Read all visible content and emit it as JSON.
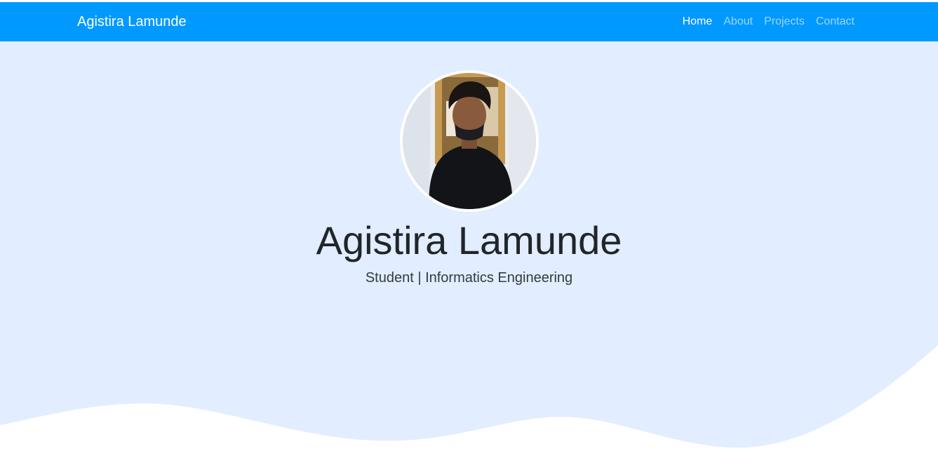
{
  "navbar": {
    "brand": "Agistira Lamunde",
    "links": [
      {
        "label": "Home",
        "active": true
      },
      {
        "label": "About",
        "active": false
      },
      {
        "label": "Projects",
        "active": false
      },
      {
        "label": "Contact",
        "active": false
      }
    ]
  },
  "hero": {
    "name": "Agistira Lamunde",
    "subtitle": "Student | Informatics Engineering"
  },
  "colors": {
    "navbar": "#0099ff",
    "hero_background": "#e2edff",
    "wave": "#ffffff"
  }
}
